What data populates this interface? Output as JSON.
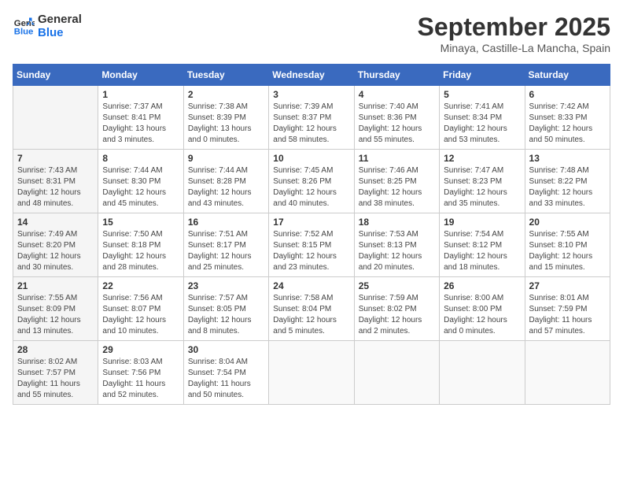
{
  "header": {
    "logo_line1": "General",
    "logo_line2": "Blue",
    "month": "September 2025",
    "location": "Minaya, Castille-La Mancha, Spain"
  },
  "days_of_week": [
    "Sunday",
    "Monday",
    "Tuesday",
    "Wednesday",
    "Thursday",
    "Friday",
    "Saturday"
  ],
  "weeks": [
    [
      {
        "day": "",
        "info": ""
      },
      {
        "day": "1",
        "info": "Sunrise: 7:37 AM\nSunset: 8:41 PM\nDaylight: 13 hours\nand 3 minutes."
      },
      {
        "day": "2",
        "info": "Sunrise: 7:38 AM\nSunset: 8:39 PM\nDaylight: 13 hours\nand 0 minutes."
      },
      {
        "day": "3",
        "info": "Sunrise: 7:39 AM\nSunset: 8:37 PM\nDaylight: 12 hours\nand 58 minutes."
      },
      {
        "day": "4",
        "info": "Sunrise: 7:40 AM\nSunset: 8:36 PM\nDaylight: 12 hours\nand 55 minutes."
      },
      {
        "day": "5",
        "info": "Sunrise: 7:41 AM\nSunset: 8:34 PM\nDaylight: 12 hours\nand 53 minutes."
      },
      {
        "day": "6",
        "info": "Sunrise: 7:42 AM\nSunset: 8:33 PM\nDaylight: 12 hours\nand 50 minutes."
      }
    ],
    [
      {
        "day": "7",
        "info": "Sunrise: 7:43 AM\nSunset: 8:31 PM\nDaylight: 12 hours\nand 48 minutes."
      },
      {
        "day": "8",
        "info": "Sunrise: 7:44 AM\nSunset: 8:30 PM\nDaylight: 12 hours\nand 45 minutes."
      },
      {
        "day": "9",
        "info": "Sunrise: 7:44 AM\nSunset: 8:28 PM\nDaylight: 12 hours\nand 43 minutes."
      },
      {
        "day": "10",
        "info": "Sunrise: 7:45 AM\nSunset: 8:26 PM\nDaylight: 12 hours\nand 40 minutes."
      },
      {
        "day": "11",
        "info": "Sunrise: 7:46 AM\nSunset: 8:25 PM\nDaylight: 12 hours\nand 38 minutes."
      },
      {
        "day": "12",
        "info": "Sunrise: 7:47 AM\nSunset: 8:23 PM\nDaylight: 12 hours\nand 35 minutes."
      },
      {
        "day": "13",
        "info": "Sunrise: 7:48 AM\nSunset: 8:22 PM\nDaylight: 12 hours\nand 33 minutes."
      }
    ],
    [
      {
        "day": "14",
        "info": "Sunrise: 7:49 AM\nSunset: 8:20 PM\nDaylight: 12 hours\nand 30 minutes."
      },
      {
        "day": "15",
        "info": "Sunrise: 7:50 AM\nSunset: 8:18 PM\nDaylight: 12 hours\nand 28 minutes."
      },
      {
        "day": "16",
        "info": "Sunrise: 7:51 AM\nSunset: 8:17 PM\nDaylight: 12 hours\nand 25 minutes."
      },
      {
        "day": "17",
        "info": "Sunrise: 7:52 AM\nSunset: 8:15 PM\nDaylight: 12 hours\nand 23 minutes."
      },
      {
        "day": "18",
        "info": "Sunrise: 7:53 AM\nSunset: 8:13 PM\nDaylight: 12 hours\nand 20 minutes."
      },
      {
        "day": "19",
        "info": "Sunrise: 7:54 AM\nSunset: 8:12 PM\nDaylight: 12 hours\nand 18 minutes."
      },
      {
        "day": "20",
        "info": "Sunrise: 7:55 AM\nSunset: 8:10 PM\nDaylight: 12 hours\nand 15 minutes."
      }
    ],
    [
      {
        "day": "21",
        "info": "Sunrise: 7:55 AM\nSunset: 8:09 PM\nDaylight: 12 hours\nand 13 minutes."
      },
      {
        "day": "22",
        "info": "Sunrise: 7:56 AM\nSunset: 8:07 PM\nDaylight: 12 hours\nand 10 minutes."
      },
      {
        "day": "23",
        "info": "Sunrise: 7:57 AM\nSunset: 8:05 PM\nDaylight: 12 hours\nand 8 minutes."
      },
      {
        "day": "24",
        "info": "Sunrise: 7:58 AM\nSunset: 8:04 PM\nDaylight: 12 hours\nand 5 minutes."
      },
      {
        "day": "25",
        "info": "Sunrise: 7:59 AM\nSunset: 8:02 PM\nDaylight: 12 hours\nand 2 minutes."
      },
      {
        "day": "26",
        "info": "Sunrise: 8:00 AM\nSunset: 8:00 PM\nDaylight: 12 hours\nand 0 minutes."
      },
      {
        "day": "27",
        "info": "Sunrise: 8:01 AM\nSunset: 7:59 PM\nDaylight: 11 hours\nand 57 minutes."
      }
    ],
    [
      {
        "day": "28",
        "info": "Sunrise: 8:02 AM\nSunset: 7:57 PM\nDaylight: 11 hours\nand 55 minutes."
      },
      {
        "day": "29",
        "info": "Sunrise: 8:03 AM\nSunset: 7:56 PM\nDaylight: 11 hours\nand 52 minutes."
      },
      {
        "day": "30",
        "info": "Sunrise: 8:04 AM\nSunset: 7:54 PM\nDaylight: 11 hours\nand 50 minutes."
      },
      {
        "day": "",
        "info": ""
      },
      {
        "day": "",
        "info": ""
      },
      {
        "day": "",
        "info": ""
      },
      {
        "day": "",
        "info": ""
      }
    ]
  ]
}
